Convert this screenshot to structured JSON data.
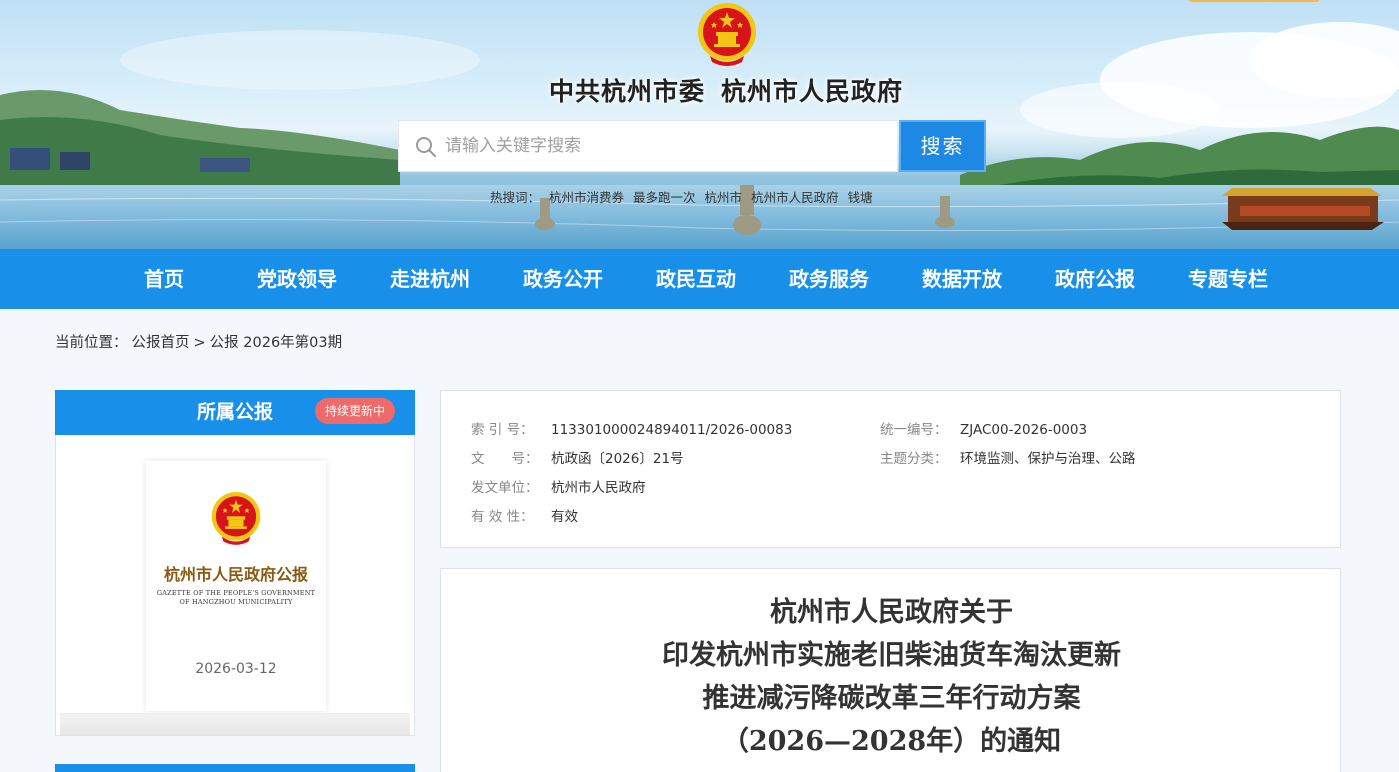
{
  "header": {
    "title_part1": "中共杭州市委",
    "title_part2": "杭州市人民政府",
    "search_placeholder": "请输入关键字搜索",
    "search_button": "搜索",
    "hot_words": [
      "热搜词：",
      "杭州市消费券",
      "最多跑一次",
      "杭州市",
      "杭州市人民政府",
      "钱塘"
    ]
  },
  "nav": {
    "items": [
      "首页",
      "党政领导",
      "走进杭州",
      "政务公开",
      "政民互动",
      "政务服务",
      "数据开放",
      "政府公报",
      "专题专栏"
    ]
  },
  "breadcrumb": {
    "prefix": "当前位置：",
    "home": "公报首页",
    "sep": ">",
    "current": "公报 2026年第03期"
  },
  "sidebar": {
    "title": "所属公报",
    "badge": "持续更新中",
    "cover_title": "杭州市人民政府公报",
    "cover_sub_line1": "GAZETTE OF THE PEOPLE'S GOVERNMENT",
    "cover_sub_line2": "OF HANGZHOU MUNICIPALITY",
    "cover_date": "2026-03-12"
  },
  "info": {
    "index_label": "索 引 号：",
    "index_value": "113301000024894011/2026-00083",
    "unified_label": "统一编号：",
    "unified_value": "ZJAC00-2026-0003",
    "doc_label": "文　　号：",
    "doc_value": "杭政函〔2026〕21号",
    "category_label": "主题分类：",
    "category_value": "环境监测、保护与治理、公路",
    "issuer_label": "发文单位：",
    "issuer_value": "杭州市人民政府",
    "validity_label": "有 效 性：",
    "validity_value": "有效"
  },
  "article": {
    "title_lines": [
      "杭州市人民政府关于",
      "印发杭州市实施老旧柴油货车淘汰更新",
      "推进减污降碳改革三年行动方案",
      "（2026—2028年）的通知"
    ]
  },
  "colors": {
    "primary_blue": "#1890ea",
    "badge_red": "#ef6a6a",
    "emblem_red": "#d8141b",
    "emblem_gold": "#f3c614"
  },
  "icons": {
    "search": "search-icon",
    "emblem": "national-emblem-icon"
  }
}
